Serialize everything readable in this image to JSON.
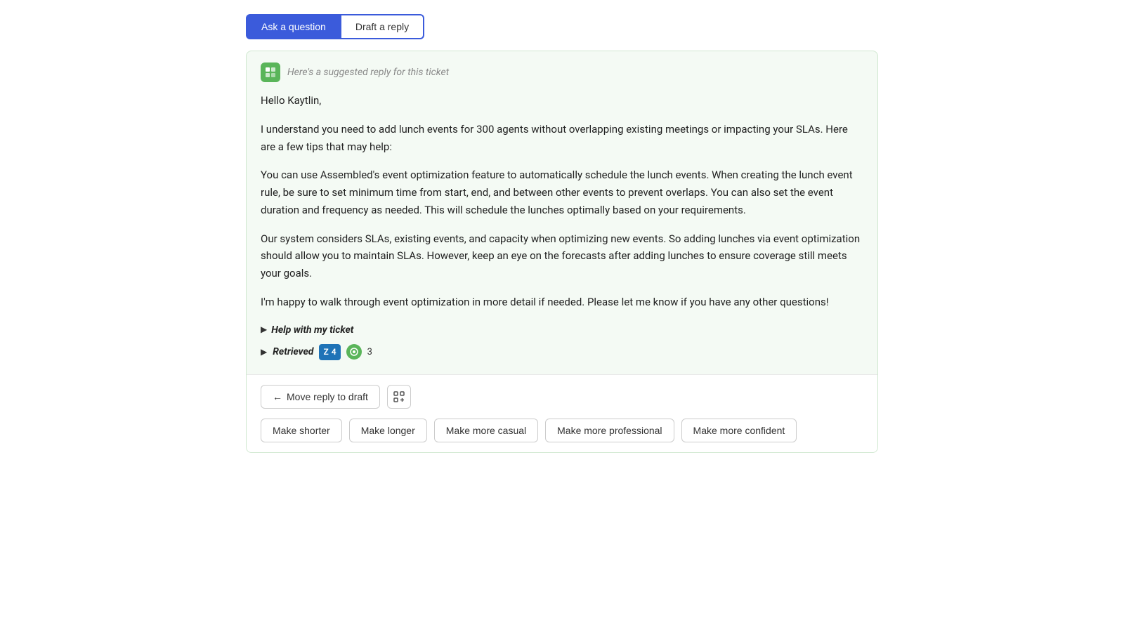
{
  "tabs": [
    {
      "id": "ask-question",
      "label": "Ask a question",
      "active": true
    },
    {
      "id": "draft-reply",
      "label": "Draft a reply",
      "active": false
    }
  ],
  "reply_card": {
    "header_text": "Here's a suggested reply for this ticket",
    "greeting": "Hello Kaytlin,",
    "paragraphs": [
      "I understand you need to add lunch events for 300 agents without overlapping existing meetings or impacting your SLAs. Here are a few tips that may help:",
      "You can use Assembled's event optimization feature to automatically schedule the lunch events. When creating the lunch event rule, be sure to set minimum time from start, end, and between other events to prevent overlaps. You can also set the event duration and frequency as needed. This will schedule the lunches optimally based on your requirements.",
      "Our system considers SLAs, existing events, and capacity when optimizing new events. So adding lunches via event optimization should allow you to maintain SLAs. However, keep an eye on the forecasts after adding lunches to ensure coverage still meets your goals.",
      "I'm happy to walk through event optimization in more detail if needed. Please let me know if you have any other questions!"
    ],
    "help_ticket_label": "Help with my ticket",
    "retrieved_label": "Retrieved",
    "badge_z_count": "4",
    "badge_g_count": "3"
  },
  "action_bar": {
    "move_to_draft_label": "Move reply to draft",
    "tone_buttons": [
      {
        "id": "make-shorter",
        "label": "Make shorter"
      },
      {
        "id": "make-longer",
        "label": "Make longer"
      },
      {
        "id": "make-more-casual",
        "label": "Make more casual"
      },
      {
        "id": "make-more-professional",
        "label": "Make more professional"
      },
      {
        "id": "make-more-confident",
        "label": "Make more confident"
      }
    ]
  }
}
